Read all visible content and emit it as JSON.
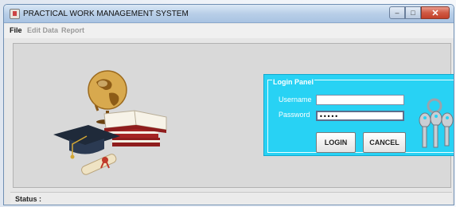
{
  "window": {
    "title": "PRACTICAL WORK MANAGEMENT SYSTEM",
    "controls": {
      "minimize": "‒",
      "maximize": "□",
      "close": "✕"
    }
  },
  "menu": [
    {
      "label": "File",
      "enabled": true
    },
    {
      "label": "Edit Data",
      "enabled": false
    },
    {
      "label": "Report",
      "enabled": false
    }
  ],
  "login_panel": {
    "title": "Login Panel",
    "username_label": "Username",
    "password_label": "Password",
    "username_value": "",
    "password_value": "•••••",
    "login_label": "LOGIN",
    "cancel_label": "CANCEL",
    "background_color": "#28d2f4"
  },
  "status": {
    "label": "Status :"
  },
  "decor": {
    "illustration": "globe-books-graduation-cap",
    "keys_icon": "keys-icon"
  }
}
